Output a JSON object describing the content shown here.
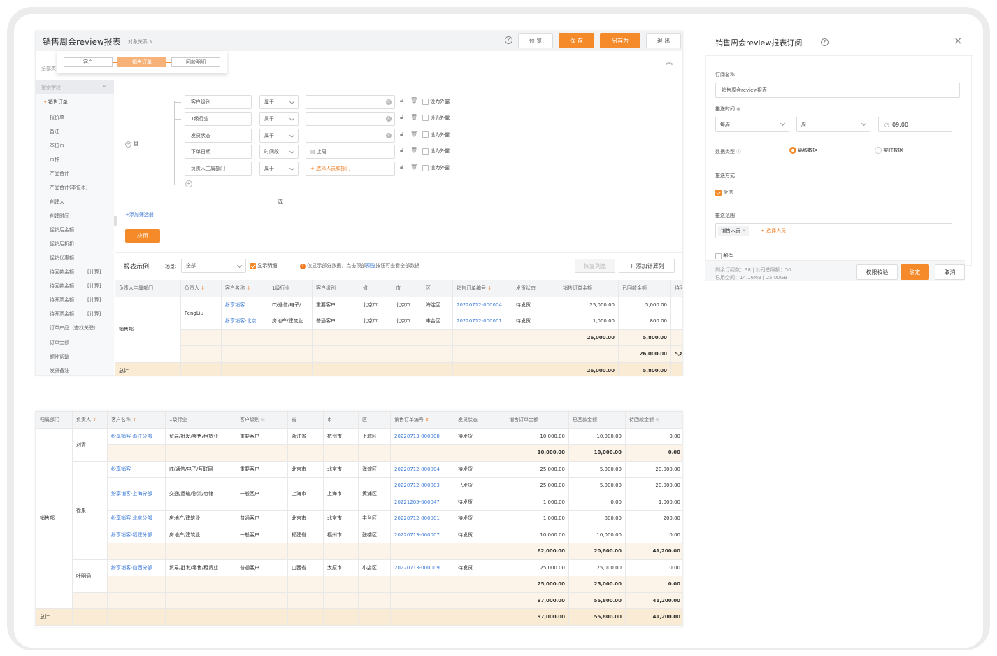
{
  "report": {
    "title": "销售周会review报表",
    "obj_rel": "对象关系",
    "buttons": {
      "preview": "预 览",
      "save": "保 存",
      "save_as": "另存为",
      "exit": "退 出"
    },
    "tabs": [
      "客户",
      "销售订单",
      "回款明细"
    ],
    "all_fields": "全部类",
    "search_placeholder": "搜索字段",
    "sidebar_group": "销售订单",
    "sidebar_items": [
      {
        "label": "报价单",
        "tag": ""
      },
      {
        "label": "备注",
        "tag": ""
      },
      {
        "label": "本位币",
        "tag": ""
      },
      {
        "label": "币种",
        "tag": ""
      },
      {
        "label": "产品合计",
        "tag": ""
      },
      {
        "label": "产品合计(本位币)",
        "tag": ""
      },
      {
        "label": "创建人",
        "tag": ""
      },
      {
        "label": "创建时间",
        "tag": ""
      },
      {
        "label": "促销后金额",
        "tag": ""
      },
      {
        "label": "促销后折扣",
        "tag": ""
      },
      {
        "label": "促销优惠额",
        "tag": ""
      },
      {
        "label": "待回款金额",
        "tag": "[计算]"
      },
      {
        "label": "待回款金额...",
        "tag": "[计算]"
      },
      {
        "label": "待开票金额",
        "tag": "[计算]"
      },
      {
        "label": "待开票金额...",
        "tag": "[计算]"
      },
      {
        "label": "订单产品（查找关联）",
        "tag": ""
      },
      {
        "label": "订单金额",
        "tag": ""
      },
      {
        "label": "额外调整",
        "tag": ""
      },
      {
        "label": "发货备注",
        "tag": ""
      }
    ],
    "logic_and": "且",
    "logic_or": "或",
    "conditions": [
      {
        "field": "客户级别",
        "op": "属于",
        "value": "",
        "ext": "设为外露"
      },
      {
        "field": "1级行业",
        "op": "属于",
        "value": "",
        "ext": "设为外露"
      },
      {
        "field": "发货状态",
        "op": "属于",
        "value": "",
        "ext": "设为外露"
      },
      {
        "field": "下单日期",
        "op": "时间段",
        "value": "上周",
        "ext": "设为外露"
      },
      {
        "field": "负责人主属部门",
        "op": "属于",
        "value": "+ 选择人员和部门",
        "ext": "设为外露"
      }
    ],
    "add_filter": "+添加筛选器",
    "apply": "应用",
    "example_title": "报表示例",
    "scene_label": "场景:",
    "scene_value": "全部",
    "show_detail": "显示明细",
    "hint": "仅显示部分数据，点击顶部",
    "hint_link": "预览",
    "hint_tail": "按钮可查看全部数据",
    "restore_cols": "恢复列宽",
    "add_calc": "+ 添加计算列",
    "columns": [
      "负责人主属部门",
      "负责人",
      "客户名称",
      "1级行业",
      "客户级别",
      "省",
      "市",
      "区",
      "销售订单编号",
      "发货状态",
      "销售订单金额",
      "已回款金额",
      "待回"
    ],
    "rows": [
      {
        "dept": "销售部",
        "owner": "FengLiu",
        "cust": "纷享销客",
        "ind": "IT/通信/电子/...",
        "lvl": "重要客户",
        "prov": "北京市",
        "city": "北京市",
        "dist": "海淀区",
        "no": "20220712-000004",
        "status": "待发货",
        "amt": "25,000.00",
        "paid": "5,000.00"
      },
      {
        "cust": "纷享销客-北京...",
        "ind": "房地产/建筑业",
        "lvl": "普通客户",
        "prov": "北京市",
        "city": "北京市",
        "dist": "丰台区",
        "no": "20220712-000001",
        "status": "待发货",
        "amt": "1,000.00",
        "paid": "800.00"
      }
    ],
    "subtotals": [
      {
        "amt": "26,000.00",
        "paid": "5,800.00"
      },
      {
        "amt": "26,000.00",
        "paid": "5,800.00"
      }
    ],
    "total_label": "总计",
    "total": {
      "amt": "26,000.00",
      "paid": "5,800.00"
    }
  },
  "big_table": {
    "columns": [
      "归属部门",
      "负责人",
      "客户名称",
      "1级行业",
      "客户级别",
      "省",
      "市",
      "区",
      "销售订单编号",
      "发货状态",
      "销售订单金额",
      "已回款金额",
      "待回款金额"
    ],
    "dept": "销售部",
    "owners": [
      "刘青",
      "徐果",
      "叶明涵"
    ],
    "rows": [
      {
        "cust": "纷享销客-浙江分部",
        "ind": "贸易/批发/零售/租赁业",
        "lvl": "重要客户",
        "prov": "浙江省",
        "city": "杭州市",
        "dist": "上城区",
        "no": "20220713-000008",
        "status": "待发货",
        "amt": "10,000.00",
        "paid": "10,000.00",
        "due": "0.00"
      },
      {
        "sub": true,
        "amt": "10,000.00",
        "paid": "10,000.00",
        "due": "0.00"
      },
      {
        "cust": "纷享销客",
        "ind": "IT/通信/电子/互联网",
        "lvl": "重要客户",
        "prov": "北京市",
        "city": "北京市",
        "dist": "海淀区",
        "no": "20220712-000004",
        "status": "待发货",
        "amt": "25,000.00",
        "paid": "5,000.00",
        "due": "20,000.00"
      },
      {
        "cust": "纷享销客-上海分部",
        "ind": "交通/运输/物流/仓储",
        "lvl": "一般客户",
        "prov": "上海市",
        "city": "上海市",
        "dist": "黄浦区",
        "no": "20220712-000003",
        "status": "已发货",
        "amt": "25,000.00",
        "paid": "5,000.00",
        "due": "20,000.00"
      },
      {
        "no": "20221205-000047",
        "status": "待发货",
        "amt": "1,000.00",
        "paid": "0.00",
        "due": "1,000.00"
      },
      {
        "cust": "纷享销客-北京分部",
        "ind": "房地产/建筑业",
        "lvl": "普通客户",
        "prov": "北京市",
        "city": "北京市",
        "dist": "丰台区",
        "no": "20220712-000001",
        "status": "待发货",
        "amt": "1,000.00",
        "paid": "800.00",
        "due": "200.00"
      },
      {
        "cust": "纷享销客-福建分部",
        "ind": "房地产/建筑业",
        "lvl": "一般客户",
        "prov": "福建省",
        "city": "福州市",
        "dist": "鼓楼区",
        "no": "20220713-000007",
        "status": "待发货",
        "amt": "10,000.00",
        "paid": "10,000.00",
        "due": "0.00"
      },
      {
        "sub": true,
        "amt": "62,000.00",
        "paid": "20,800.00",
        "due": "41,200.00"
      },
      {
        "cust": "纷享销客-山西分部",
        "ind": "贸易/批发/零售/租赁业",
        "lvl": "普通客户",
        "prov": "山西省",
        "city": "太原市",
        "dist": "小店区",
        "no": "20220713-000009",
        "status": "待发货",
        "amt": "25,000.00",
        "paid": "25,000.00",
        "due": "0.00"
      },
      {
        "sub": true,
        "amt": "25,000.00",
        "paid": "25,000.00",
        "due": "0.00"
      },
      {
        "sub": true,
        "amt": "97,000.00",
        "paid": "55,800.00",
        "due": "41,200.00"
      }
    ],
    "total_label": "总计",
    "total": {
      "amt": "97,000.00",
      "paid": "55,800.00",
      "due": "41,200.00"
    }
  },
  "subscribe": {
    "title": "销售周会review报表订阅",
    "name_label": "订阅名称",
    "name_value": "销售周会review报表",
    "time_label": "推送时间",
    "freq": "每周",
    "day": "周一",
    "time": "09:00",
    "data_type_label": "数据类型",
    "offline": "离线数据",
    "realtime": "实时数据",
    "method_label": "推送方式",
    "method": "企信",
    "range_label": "推送范围",
    "range_tag": "销售人员",
    "range_add": "+ 选择人员",
    "mail": "邮件",
    "quota_line1": "剩余订阅数：38 | 公司总限额：50",
    "quota_line2": "已用空间：14.16MB | 25.00GB",
    "perm_check": "权限校验",
    "confirm": "确定",
    "cancel": "取消"
  },
  "colors": {
    "accent": "#f58a2a",
    "link": "#3d7bd8",
    "subtotal": "#fcf4e8",
    "total": "#faebd4"
  }
}
